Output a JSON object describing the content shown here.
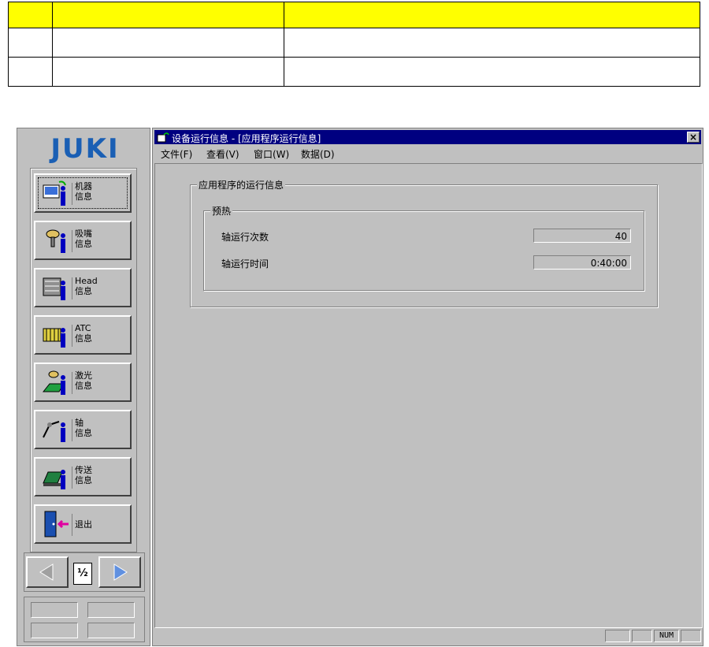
{
  "window": {
    "title": "设备运行信息 - [应用程序运行信息]",
    "close_label": "×"
  },
  "menu": [
    {
      "label": "文件(F)"
    },
    {
      "label": "查看(V)"
    },
    {
      "label": "窗口(W)"
    },
    {
      "label": "数据(D)"
    }
  ],
  "sidebar": {
    "logo_text": "JUKI",
    "items": [
      {
        "label": "机器\n信息"
      },
      {
        "label": "吸嘴\n信息"
      },
      {
        "label": "Head\n信息"
      },
      {
        "label": "ATC\n信息"
      },
      {
        "label": "激光\n信息"
      },
      {
        "label": "轴\n信息"
      },
      {
        "label": "传送\n信息"
      },
      {
        "label": "退出"
      }
    ],
    "page_indicator": "½"
  },
  "content": {
    "group_title": "应用程序的运行信息",
    "sub_group_title": "预热",
    "fields": [
      {
        "label": "轴运行次数",
        "value": "40"
      },
      {
        "label": "轴运行时间",
        "value": "0:40:00"
      }
    ]
  },
  "statusbar": {
    "num_label": "NUM"
  },
  "colors": {
    "titlebar": "#000080",
    "panel": "#c0c0c0",
    "logo": "#1a5fb4",
    "table_header": "#ffff00"
  }
}
